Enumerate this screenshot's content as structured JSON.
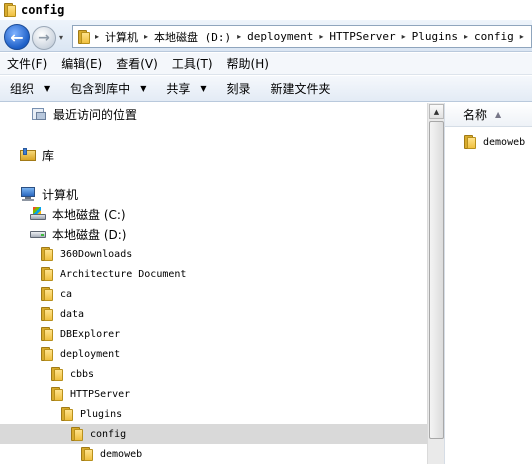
{
  "window": {
    "title": "config"
  },
  "nav": {
    "back_glyph": "←",
    "forward_glyph": "→",
    "recent_glyph": "▾"
  },
  "address": {
    "separator": "▸",
    "crumbs": [
      "计算机",
      "本地磁盘 (D:)",
      "deployment",
      "HTTPServer",
      "Plugins",
      "config"
    ]
  },
  "menu": {
    "items": [
      "文件(F)",
      "编辑(E)",
      "查看(V)",
      "工具(T)",
      "帮助(H)"
    ]
  },
  "toolbar": {
    "organize": "组织",
    "include_in_library": "包含到库中",
    "share": "共享",
    "burn": "刻录",
    "new_folder": "新建文件夹",
    "caret": "▼"
  },
  "tree": {
    "recent": "最近访问的位置",
    "libraries": "库",
    "computer": "计算机",
    "drive_c": "本地磁盘 (C:)",
    "drive_d": "本地磁盘 (D:)",
    "folders": {
      "f1": "360Downloads",
      "f2": "Architecture Document",
      "f3": "ca",
      "f4": "data",
      "f5": "DBExplorer",
      "f6": "deployment",
      "f7": "cbbs",
      "f8": "HTTPServer",
      "f9": "Plugins",
      "f10": "config",
      "f11": "demoweb"
    }
  },
  "scrollbar": {
    "up_glyph": "▲"
  },
  "content": {
    "column_name": "名称",
    "sort_glyph": "▲",
    "files": [
      "demoweb"
    ]
  },
  "colors": {
    "folder": "#f0c040",
    "selected_row": "#d9d9d9",
    "nav_back": "#1d5fc7"
  },
  "icons": {
    "folder": "folder-icon",
    "computer": "computer-icon",
    "drive": "drive-icon",
    "library": "library-icon",
    "recent": "recent-places-icon"
  }
}
